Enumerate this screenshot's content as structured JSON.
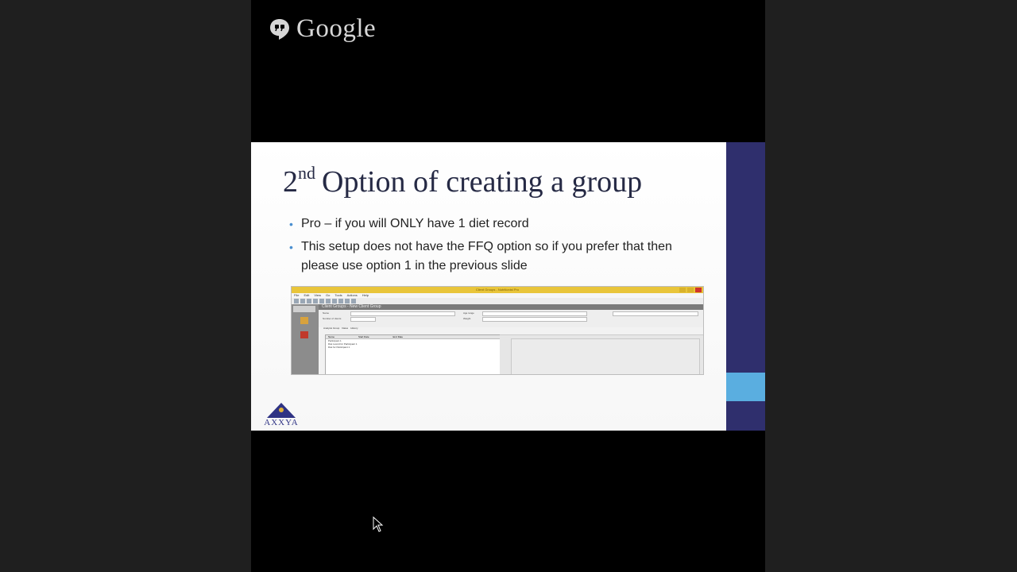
{
  "brand": {
    "name": "Google",
    "icon": "hangouts-icon"
  },
  "slide": {
    "title_prefix": "2",
    "title_sup": "nd",
    "title_rest": "Option of creating a group",
    "bullets": [
      "Pro – if you will ONLY have 1 diet record",
      "This setup does not have the FFQ option so if you prefer that then please use option 1 in the previous slide"
    ],
    "logo_text": "AXXYA",
    "colors": {
      "band": "#2f2f6d",
      "band_accent": "#5aaee0",
      "title": "#262a45",
      "bullet": "#4a8fd0"
    }
  },
  "screenshot": {
    "window_title": "Client Groups - Nutritionist Pro",
    "menu": [
      "File",
      "Edit",
      "View",
      "Go",
      "Tools",
      "Actions",
      "Help"
    ],
    "panel_header": "Client Groups - New Client Group",
    "labels": {
      "name": "Name",
      "number_of_clients": "Number of clients",
      "age_range": "Age range",
      "weight": "Weight"
    },
    "tabs": [
      "Analysis Group",
      "Dates",
      "History"
    ],
    "grid_columns": [
      "Name",
      "Start Date",
      "End Date"
    ],
    "grid_rows": [
      "Participant 1",
      "Diet record for Participant 1",
      "Diet for Participant 1"
    ]
  },
  "cursor": {
    "icon": "mouse-pointer-icon"
  }
}
